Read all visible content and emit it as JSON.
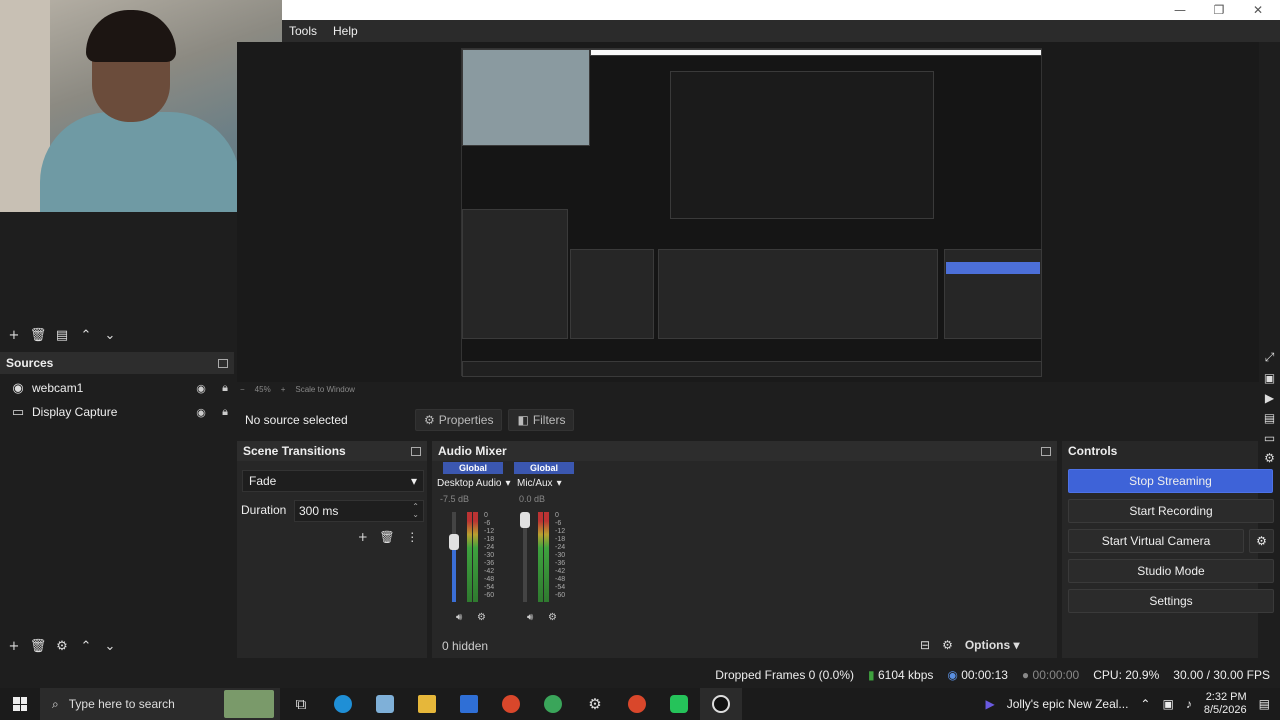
{
  "menu": {
    "tools": "Tools",
    "help": "Help"
  },
  "window": {
    "minimize": "—",
    "restore": "❐",
    "close": "✕"
  },
  "sources": {
    "title": "Sources",
    "items": [
      {
        "label": "webcam1",
        "icon": "camera-icon"
      },
      {
        "label": "Display Capture",
        "icon": "monitor-icon"
      }
    ]
  },
  "preview": {
    "zoom": "45%",
    "scale_mode": "Scale to Window"
  },
  "source_bar": {
    "no_source": "No source selected",
    "properties": "Properties",
    "filters": "Filters"
  },
  "transitions": {
    "title": "Scene Transitions",
    "selected": "Fade",
    "duration_label": "Duration",
    "duration_value": "300 ms"
  },
  "mixer": {
    "title": "Audio Mixer",
    "channels": [
      {
        "scope": "Global",
        "name": "Desktop Audio",
        "db": "-7.5 dB",
        "level": 0.7
      },
      {
        "scope": "Global",
        "name": "Mic/Aux",
        "db": "0.0 dB",
        "level": 1.0
      }
    ],
    "scale": [
      "0",
      "-6",
      "-12",
      "-18",
      "-24",
      "-30",
      "-36",
      "-42",
      "-48",
      "-54",
      "-60"
    ],
    "hidden": "0 hidden",
    "options": "Options"
  },
  "controls": {
    "title": "Controls",
    "stop_streaming": "Stop Streaming",
    "start_recording": "Start Recording",
    "start_virtual_camera": "Start Virtual Camera",
    "studio_mode": "Studio Mode",
    "settings": "Settings"
  },
  "status": {
    "dropped_frames": "Dropped Frames 0 (0.0%)",
    "bitrate": "6104 kbps",
    "stream_time": "00:00:13",
    "record_time": "00:00:00",
    "cpu": "CPU: 20.9%",
    "fps": "30.00 / 30.00 FPS"
  },
  "taskbar": {
    "search_placeholder": "Type here to search",
    "media_title": "Jolly's epic New Zeal...",
    "time": "2:32 PM",
    "date": "8/5/2026"
  },
  "colors": {
    "accent": "#3e63d8",
    "panel": "#272727",
    "background": "#1e1e1e"
  }
}
